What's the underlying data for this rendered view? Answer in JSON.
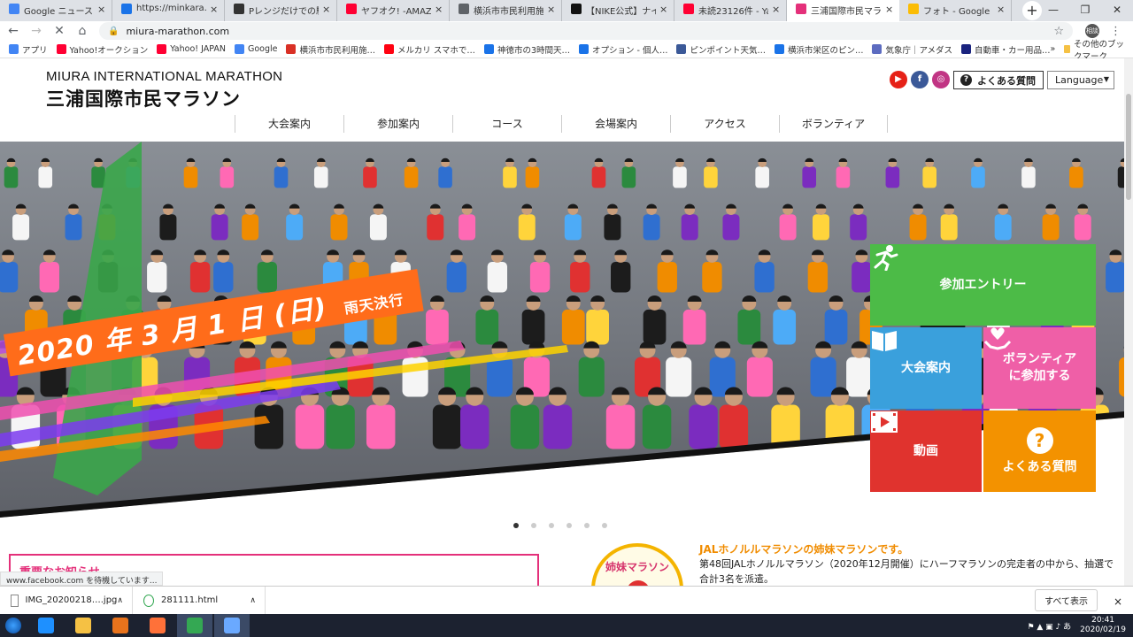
{
  "browser": {
    "tabs": [
      {
        "title": "Google ニュース",
        "icon": "google-news-icon",
        "color": "#4285f4"
      },
      {
        "title": "https://minkara.carv",
        "icon": "minkara-icon",
        "color": "#1a73e8"
      },
      {
        "title": "Pレンジだけでの駐車",
        "icon": "page-icon",
        "color": "#333333"
      },
      {
        "title": "ヤフオク! -AMAZFIT",
        "icon": "yahoo-icon",
        "color": "#ff0033"
      },
      {
        "title": "横浜市市民利用施設予",
        "icon": "globe-icon",
        "color": "#5f6368"
      },
      {
        "title": "【NIKE公式】ナイキ",
        "icon": "nike-icon",
        "color": "#111111"
      },
      {
        "title": "未読23126件 - Yahoo",
        "icon": "yahoo-mail-icon",
        "color": "#ff0033"
      },
      {
        "title": "三浦国際市民マラソン",
        "icon": "marathon-icon",
        "color": "#e4307a",
        "active": true
      },
      {
        "title": "フォト - Google フォ",
        "icon": "google-photos-icon",
        "color": "#fbbc04"
      }
    ],
    "new_tab": "+",
    "url": "miura-marathon.com",
    "avatar": "相談",
    "bookmarks": [
      {
        "label": "アプリ",
        "icon": "apps-icon",
        "color": "#4285f4"
      },
      {
        "label": "Yahoo!オークション",
        "icon": "yahoo-icon",
        "color": "#ff0033"
      },
      {
        "label": "Yahoo! JAPAN",
        "icon": "yahoo-icon",
        "color": "#ff0033"
      },
      {
        "label": "Google",
        "icon": "google-icon",
        "color": "#4285f4"
      },
      {
        "label": "横浜市市民利用施…",
        "icon": "yokohama-icon",
        "color": "#d93025"
      },
      {
        "label": "メルカリ スマホで…",
        "icon": "mercari-icon",
        "color": "#ff0211"
      },
      {
        "label": "神徳市の3時間天…",
        "icon": "weather-icon",
        "color": "#1a73e8"
      },
      {
        "label": "オプション - 個人…",
        "icon": "gear-icon",
        "color": "#1a73e8"
      },
      {
        "label": "ピンポイント天気…",
        "icon": "tenki-icon",
        "color": "#3b5998"
      },
      {
        "label": "横浜市栄区のピン…",
        "icon": "weather-icon",
        "color": "#1a73e8"
      },
      {
        "label": "気象庁｜アメダス",
        "icon": "jma-icon",
        "color": "#5c6bc0"
      },
      {
        "label": "自動車・カー用品…",
        "icon": "car-icon",
        "color": "#1a237e"
      }
    ],
    "bookmarks_more": "»",
    "other_bookmarks": "その他のブックマーク"
  },
  "site": {
    "logo_en": "MIURA INTERNATIONAL MARATHON",
    "logo_ja": "三浦国際市民マラソン",
    "social": [
      {
        "name": "youtube-icon",
        "glyph": "▶",
        "color": "#e62117"
      },
      {
        "name": "facebook-icon",
        "glyph": "f",
        "color": "#3b5998"
      },
      {
        "name": "instagram-icon",
        "glyph": "◎",
        "color": "#c13584"
      }
    ],
    "faq_button": "よくある質問",
    "faq_glyph": "?",
    "language": "Language",
    "nav": [
      "大会案内",
      "参加案内",
      "コース",
      "会場案内",
      "アクセス",
      "ボランティア"
    ],
    "hero": {
      "date_main": "2020 年 3 月 1 日 (日)",
      "date_note": "雨天決行",
      "date_color": "#ff6c1a"
    },
    "tiles": {
      "entry": {
        "label": "参加エントリー",
        "color": "#4cbb47",
        "icon": "runner-icon"
      },
      "guide": {
        "label": "大会案内",
        "color": "#3aa0dc",
        "icon": "book-icon"
      },
      "volunteer": {
        "label1": "ボランティア",
        "label2": "に参加する",
        "color": "#ef5fa7",
        "icon": "heart-hands-icon"
      },
      "video": {
        "label": "動画",
        "color": "#e0332e",
        "icon": "film-icon"
      },
      "faq": {
        "label": "よくある質問",
        "color": "#f39200",
        "icon": "question-icon",
        "glyph": "?"
      }
    },
    "slides": 6,
    "active_slide": 0,
    "notice_title": "重要なお知らせ",
    "status_bubble": "www.facebook.com を待機しています...",
    "sister": {
      "badge": "姉妹マラソン",
      "title": "JALホノルルマラソンの姉妹マラソンです。",
      "text": "第48回JALホノルルマラソン（2020年12月開催）にハーフマラソンの完走者の中から、抽選で合計3名を派遣。"
    }
  },
  "downloads": {
    "items": [
      {
        "name": "IMG_20200218….jpg",
        "icon": "image-file-icon"
      },
      {
        "name": "281111.html",
        "icon": "chrome-file-icon"
      }
    ],
    "show_all": "すべて表示",
    "close": "×"
  },
  "taskbar": {
    "apps": [
      {
        "name": "ie-icon",
        "color": "#1e90ff"
      },
      {
        "name": "explorer-icon",
        "color": "#f5c144"
      },
      {
        "name": "media-player-icon",
        "color": "#e8731c"
      },
      {
        "name": "firefox-icon",
        "color": "#ff7139"
      },
      {
        "name": "chrome-icon",
        "color": "#34a853",
        "active": true
      },
      {
        "name": "app-icon",
        "color": "#6aa9ff",
        "active": true
      }
    ],
    "time": "20:41",
    "date": "2020/02/19"
  }
}
